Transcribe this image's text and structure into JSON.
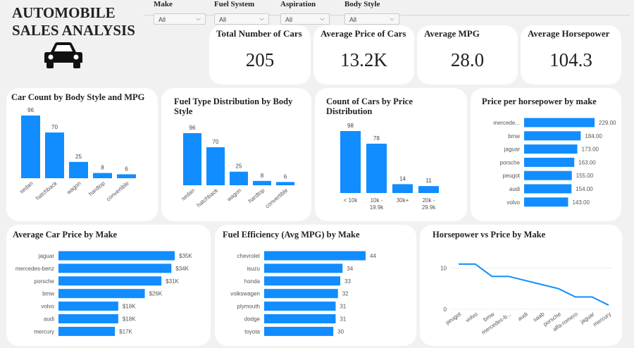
{
  "header": {
    "title_line1": "AUTOMOBILE",
    "title_line2": "SALES ANALYSIS",
    "logo_icon": "car-icon"
  },
  "filters": [
    {
      "label": "Make",
      "value": "All"
    },
    {
      "label": "Fuel System",
      "value": "All"
    },
    {
      "label": "Aspiration",
      "value": "All"
    },
    {
      "label": "Body Style",
      "value": "All"
    }
  ],
  "kpis": [
    {
      "label": "Total Number of Cars",
      "value": "205"
    },
    {
      "label": "Average Price of Cars",
      "value": "13.2K"
    },
    {
      "label": "Average MPG",
      "value": "28.0"
    },
    {
      "label": "Average Horsepower",
      "value": "104.3"
    }
  ],
  "colors": {
    "bar": "#118DFF",
    "background": "#F1F1F1",
    "card": "#FFFFFF"
  },
  "chart_data": [
    {
      "id": "body_mpg",
      "type": "bar",
      "title": "Car Count by Body Style and MPG",
      "categories": [
        "sedan",
        "hatchback",
        "wagon",
        "hardtop",
        "convertible"
      ],
      "values": [
        96,
        70,
        25,
        8,
        6
      ]
    },
    {
      "id": "fuel_body",
      "type": "bar",
      "title": "Fuel Type Distribution by Body Style",
      "categories": [
        "sedan",
        "hatchback",
        "wagon",
        "hardtop",
        "convertible"
      ],
      "values": [
        96,
        70,
        25,
        8,
        6
      ]
    },
    {
      "id": "price_dist",
      "type": "bar",
      "title": "Count of Cars by Price Distribution",
      "categories": [
        "< 10k",
        "10k - 19.9k",
        "30k+",
        "20k - 29.9k"
      ],
      "values": [
        98,
        78,
        14,
        11
      ]
    },
    {
      "id": "price_hp",
      "type": "bar",
      "orientation": "horizontal",
      "title": "Price per horsepower by make",
      "categories": [
        "mercede...",
        "bmw",
        "jaguar",
        "porsche",
        "peugot",
        "audi",
        "volvo"
      ],
      "values": [
        229.0,
        184.0,
        173.0,
        163.0,
        155.0,
        154.0,
        143.0
      ],
      "labels": [
        "229.00",
        "184.00",
        "173.00",
        "163.00",
        "155.00",
        "154.00",
        "143.00"
      ]
    },
    {
      "id": "avg_price",
      "type": "bar",
      "orientation": "horizontal",
      "title": "Average Car Price by Make",
      "categories": [
        "jaguar",
        "mercedes-benz",
        "porsche",
        "bmw",
        "volvo",
        "audi",
        "mercury"
      ],
      "values": [
        35,
        34,
        31,
        26,
        18,
        18,
        17
      ],
      "labels": [
        "$35K",
        "$34K",
        "$31K",
        "$26K",
        "$18K",
        "$18K",
        "$17K"
      ]
    },
    {
      "id": "fuel_eff",
      "type": "bar",
      "orientation": "horizontal",
      "title": "Fuel Efficiency (Avg MPG) by Make",
      "categories": [
        "chevrolet",
        "isuzu",
        "honda",
        "volkswagen",
        "plymouth",
        "dodge",
        "toyota"
      ],
      "values": [
        44,
        34,
        33,
        32,
        31,
        31,
        30
      ],
      "labels": [
        "44",
        "34",
        "33",
        "32",
        "31",
        "31",
        "30"
      ]
    },
    {
      "id": "hp_price",
      "type": "line",
      "title": "Horsepower vs Price by Make",
      "x": [
        "peugot",
        "volvo",
        "bmw",
        "mercedes-b...",
        "audi",
        "saab",
        "porsche",
        "alfa-romero",
        "jaguar",
        "mercury"
      ],
      "values": [
        11,
        11,
        8,
        8,
        7,
        6,
        5,
        3,
        3,
        1
      ],
      "ylim": [
        0,
        12
      ],
      "yticks": [
        0,
        10
      ]
    }
  ]
}
